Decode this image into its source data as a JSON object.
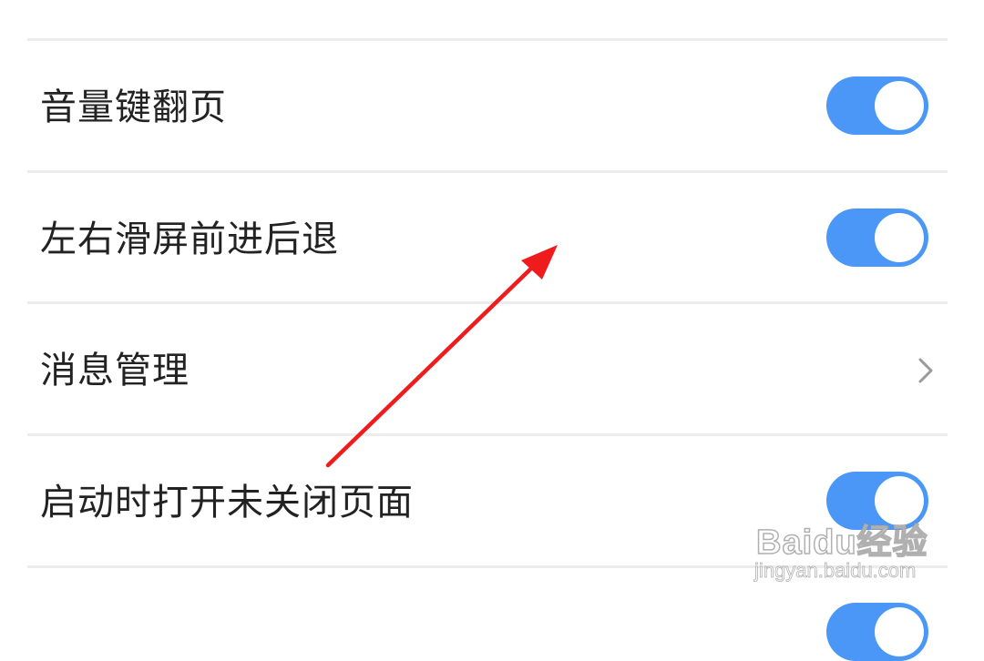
{
  "settings": {
    "rows": [
      {
        "label": "音量键翻页",
        "control": "toggle",
        "enabled": true
      },
      {
        "label": "左右滑屏前进后退",
        "control": "toggle",
        "enabled": true
      },
      {
        "label": "消息管理",
        "control": "chevron"
      },
      {
        "label": "启动时打开未关闭页面",
        "control": "toggle",
        "enabled": true
      }
    ]
  },
  "colors": {
    "toggle_on": "#4a97f7",
    "annotation_arrow": "#ee1c1c",
    "divider": "#ececec"
  },
  "icons": {
    "chevron": "chevron-right-icon",
    "arrow": "red-arrow-annotation"
  },
  "watermark": {
    "brand": "Baidu经验",
    "url": "jingyan.baidu.com"
  }
}
